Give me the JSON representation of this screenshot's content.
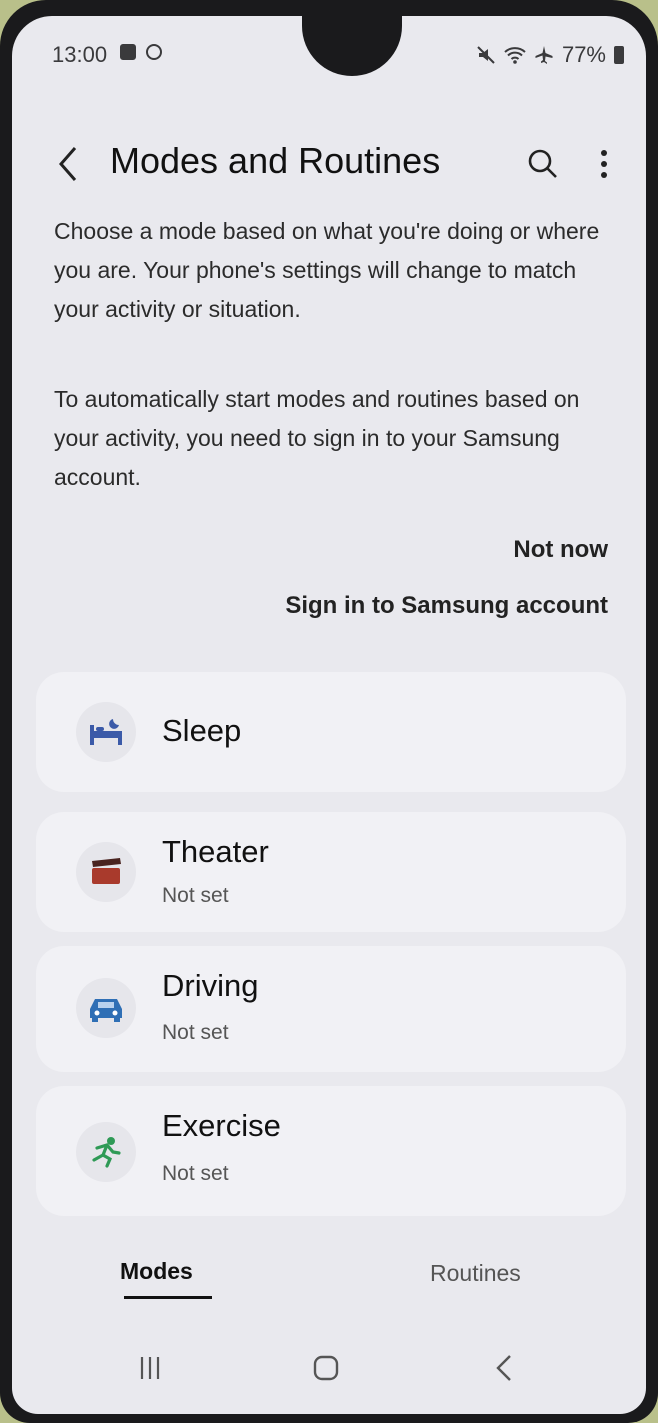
{
  "status_bar": {
    "time": "13:00",
    "battery": "77%"
  },
  "header": {
    "title": "Modes and Routines"
  },
  "description": {
    "paragraph_1": "Choose a mode based on what you're doing or where you are. Your phone's settings will change to match your activity or situation.",
    "paragraph_2": "To automatically start modes and routines based on your activity, you need to sign in to your Samsung account."
  },
  "actions": {
    "not_now": "Not now",
    "sign_in": "Sign in to Samsung account"
  },
  "modes": [
    {
      "name": "Sleep",
      "status": "",
      "icon": "bed-icon",
      "color": "#3b5aa8"
    },
    {
      "name": "Theater",
      "status": "Not set",
      "icon": "clapperboard-icon",
      "color": "#a93a2c"
    },
    {
      "name": "Driving",
      "status": "Not set",
      "icon": "car-icon",
      "color": "#2f6fb5"
    },
    {
      "name": "Exercise",
      "status": "Not set",
      "icon": "running-icon",
      "color": "#2f9a56"
    }
  ],
  "tabs": {
    "modes": "Modes",
    "routines": "Routines"
  }
}
